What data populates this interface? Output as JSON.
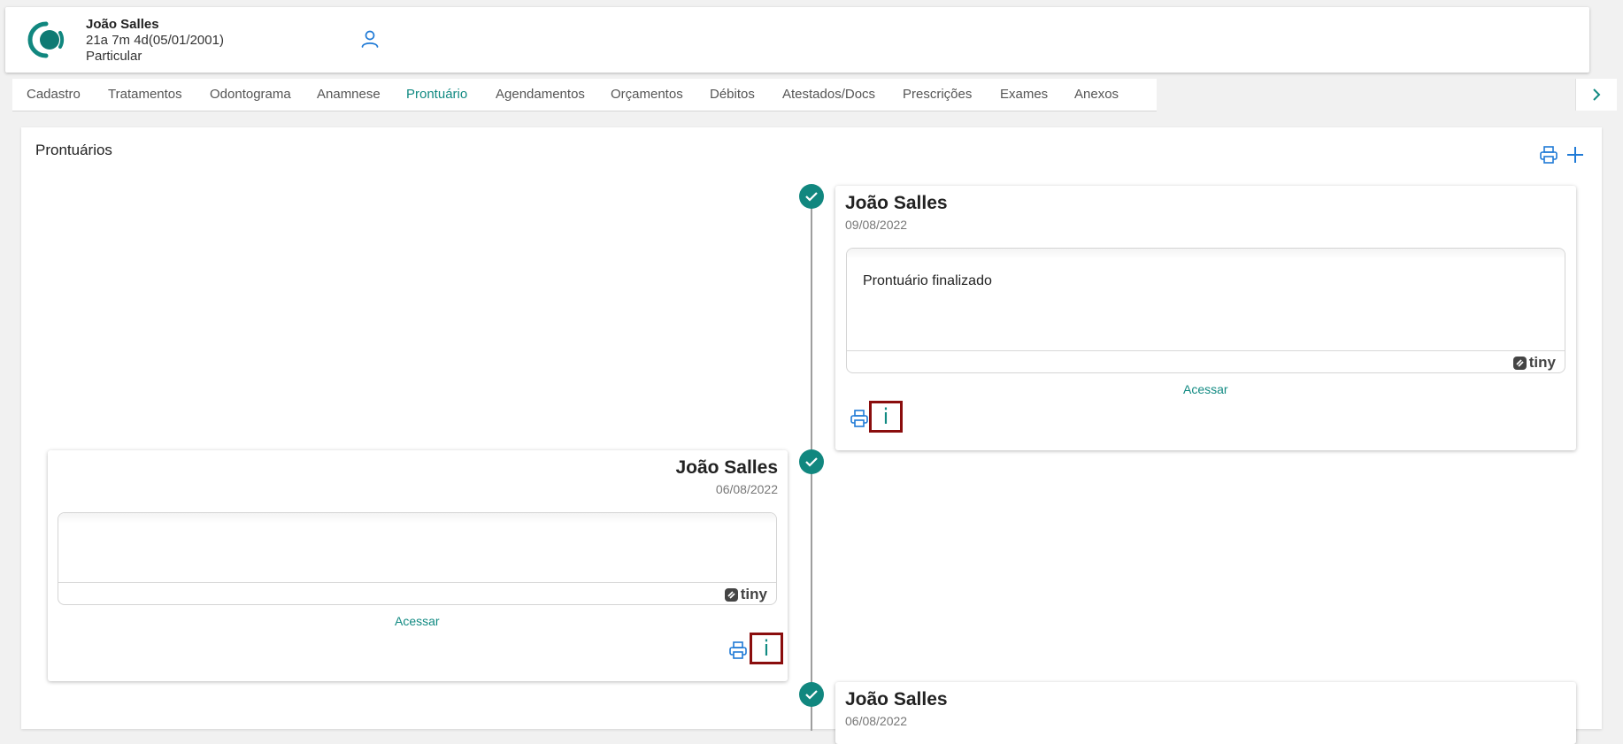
{
  "patient": {
    "name": "João Salles",
    "age_birth": "21a 7m 4d(05/01/2001)",
    "plan": "Particular"
  },
  "tabs": [
    {
      "label": "Cadastro"
    },
    {
      "label": "Tratamentos"
    },
    {
      "label": "Odontograma"
    },
    {
      "label": "Anamnese"
    },
    {
      "label": "Prontuário",
      "active": true
    },
    {
      "label": "Agendamentos"
    },
    {
      "label": "Orçamentos"
    },
    {
      "label": "Débitos"
    },
    {
      "label": "Atestados/Docs"
    },
    {
      "label": "Prescrições"
    },
    {
      "label": "Exames"
    },
    {
      "label": "Anexos"
    }
  ],
  "panel": {
    "title": "Prontuários"
  },
  "records": [
    {
      "name": "João Salles",
      "date": "09/08/2022",
      "content": "Prontuário finalizado",
      "editor_brand": "tiny",
      "link": "Acessar",
      "info": "i"
    },
    {
      "name": "João Salles",
      "date": "06/08/2022",
      "content": "",
      "editor_brand": "tiny",
      "link": "Acessar",
      "info": "i"
    },
    {
      "name": "João Salles",
      "date": "06/08/2022"
    }
  ],
  "icons": {
    "logo": "clinic-logo",
    "user": "user-icon",
    "print": "printer-icon",
    "add": "plus-icon",
    "check": "check-icon",
    "chevron": "chevron-right-icon"
  },
  "colors": {
    "accent": "#11877f",
    "highlight_border": "#8a0d0d",
    "print_icon": "#1f7ad6"
  }
}
